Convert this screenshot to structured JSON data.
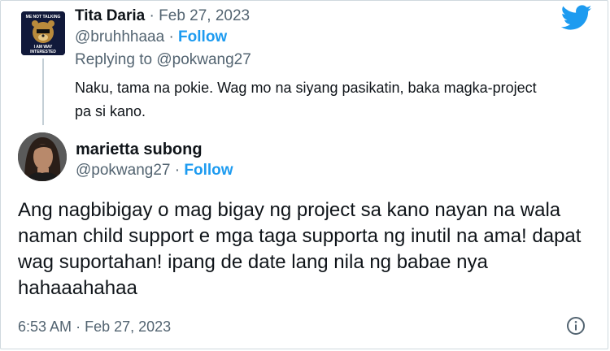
{
  "reply_tweet": {
    "display_name": "Tita Daria",
    "separator": "·",
    "date": "Feb 27, 2023",
    "handle": "@bruhhhaaa",
    "follow_label": "Follow",
    "replying_prefix": "Replying to",
    "replying_mention": "@pokwang27",
    "text": "Naku, tama na pokie. Wag mo na siyang pasikatin, baka magka-project pa si kano.",
    "avatar_icon": "bear-logo-avatar",
    "avatar_text_top": "ME NOT TALKING",
    "avatar_text_bottom_1": "I AM WAY",
    "avatar_text_bottom_2": "INTERESTED"
  },
  "main_tweet": {
    "display_name": "marietta subong",
    "handle": "@pokwang27",
    "follow_label": "Follow",
    "text": "Ang nagbibigay o mag bigay ng project sa kano nayan na wala naman child support e mga taga supporta ng inutil na ama! dapat wag suportahan! ipang de date lang nila ng babae nya hahaaahahaa",
    "time": "6:53 AM",
    "date": "Feb 27, 2023",
    "separator": "·"
  },
  "icons": {
    "brand": "twitter-bird-icon",
    "info": "info-icon"
  },
  "colors": {
    "brand_blue": "#1d9bf0",
    "text_primary": "#0f1419",
    "text_secondary": "#536471",
    "thread_line": "#c4cfd6"
  }
}
